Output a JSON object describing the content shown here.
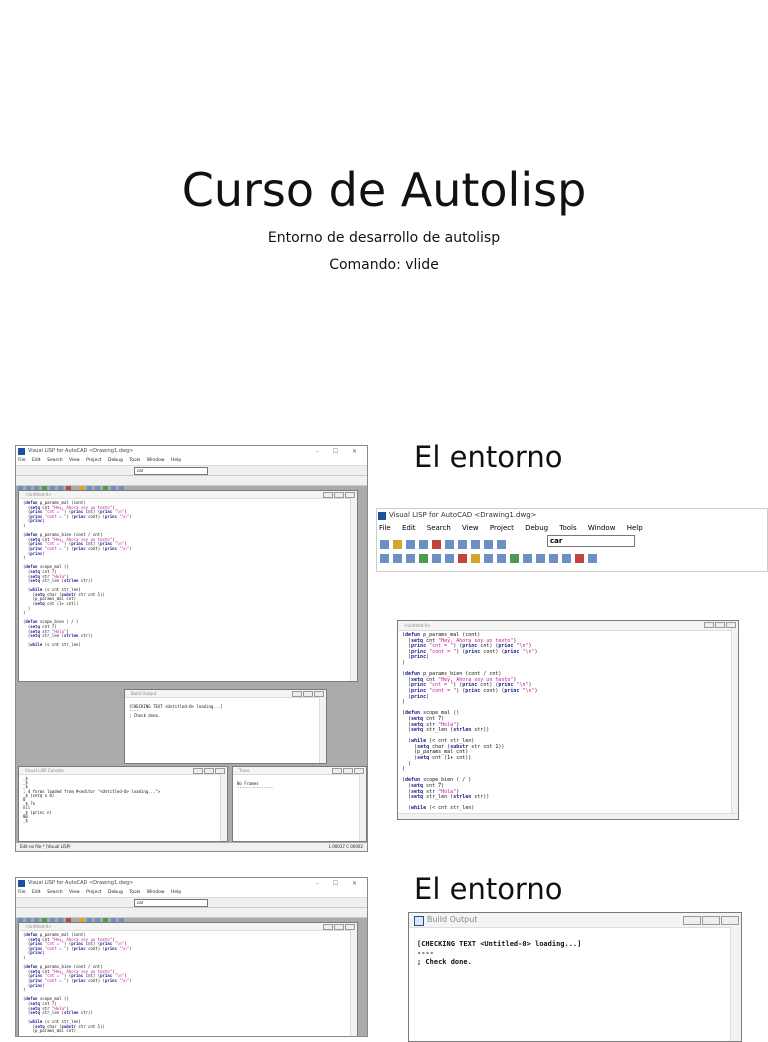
{
  "slide": {
    "title": "Curso de Autolisp",
    "subtitle_line1": "Entorno de desarrollo de autolisp",
    "subtitle_line2": "Comando: vlide"
  },
  "section1": {
    "heading": "El entorno"
  },
  "section2": {
    "heading": "El entorno"
  },
  "vlisp": {
    "window_title": "Visual LISP for AutoCAD <Drawing1.dwg>",
    "window_controls": "–  ☐  ✕",
    "menu": [
      "File",
      "Edit",
      "Search",
      "View",
      "Project",
      "Debug",
      "Tools",
      "Window",
      "Help"
    ],
    "search_value": "car",
    "editor_title": "<Untitled-0>",
    "code_lines": [
      "(defun p_params_mal (cont)",
      "  (setq cnt \"Hey, Ahora soy un texto\")",
      "  (princ \"cnt = \") (princ cnt) (princ \"\\n\")",
      "  (princ \"cont = \") (princ cont) (princ \"\\n\")",
      "  (princ)",
      ")",
      "",
      "(defun p_params_bien (cont / cnt)",
      "  (setq cnt \"Hey, Ahora soy un texto\")",
      "  (princ \"cnt = \") (princ cnt) (princ \"\\n\")",
      "  (princ \"cont = \") (princ cont) (princ \"\\n\")",
      "  (princ)",
      ")",
      "",
      "(defun scope_mal ()",
      "  (setq cnt 7)",
      "  (setq str \"Hola\")",
      "  (setq str_len (strlen str))",
      "",
      "  (while (< cnt str_len)",
      "    (setq char (substr str cnt 1))",
      "    (p_params_mal cnt)",
      "    (setq cnt (1+ cnt))",
      "  )",
      ")",
      "",
      "(defun scope_bien ( / )",
      "  (setq cnt 7)",
      "  (setq str \"Hola\")",
      "  (setq str_len (strlen str))",
      "",
      "  (while (< cnt str_len)"
    ],
    "build_output_title": "Build Output",
    "build_output_lines": [
      "[CHECKING TEXT <Untitled-0> loading...]",
      "----",
      "; Check done."
    ],
    "console_title": "Visual LISP Console",
    "console_lines": [
      "_$",
      "_$",
      "_$",
      "; 4 forms loaded from #<editor \"<Untitled-0> loading...\">",
      "_$ (setq n 0)",
      "0",
      "_$ ?n",
      "nil",
      "_$ (princ n)",
      "00",
      "_$"
    ],
    "trace_title": "Trace",
    "trace_lines": [
      "No Frames",
      "---------------"
    ],
    "status_left": "Edit   no file * (Visual LISP)",
    "status_right": "L 00037  C 00002"
  }
}
